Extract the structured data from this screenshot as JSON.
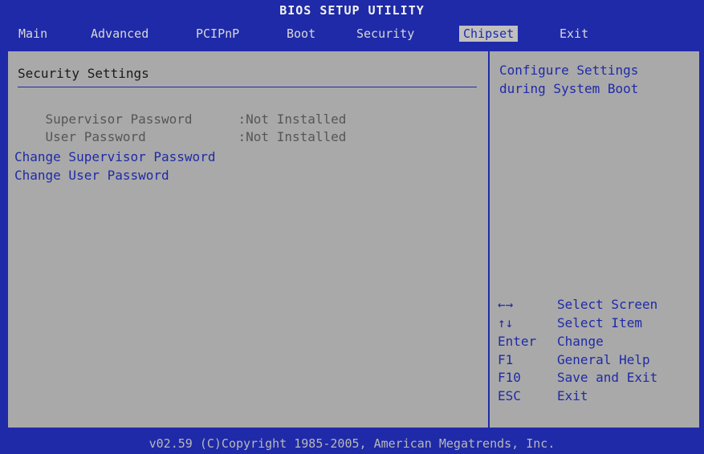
{
  "window": {
    "title": "BIOS SETUP UTILITY"
  },
  "menu": {
    "items": [
      "Main",
      "Advanced",
      "PCIPnP",
      "Boot",
      "Security",
      "Chipset",
      "Exit"
    ],
    "active": "Chipset"
  },
  "main": {
    "section_title": "Security Settings",
    "status": [
      {
        "label": "Supervisor Password",
        "value": ":Not Installed"
      },
      {
        "label": "User Password",
        "value": ":Not Installed"
      }
    ],
    "actions": [
      "Change Supervisor Password",
      "Change User Password"
    ]
  },
  "help_panel": {
    "description": "Configure Settings during System Boot",
    "keys": [
      {
        "key": "←→",
        "action": "Select Screen"
      },
      {
        "key": "↑↓",
        "action": "Select Item"
      },
      {
        "key": "Enter",
        "action": "Change"
      },
      {
        "key": "F1",
        "action": "General Help"
      },
      {
        "key": "F10",
        "action": "Save and Exit"
      },
      {
        "key": "ESC",
        "action": "Exit"
      }
    ]
  },
  "footer": {
    "text": "v02.59 (C)Copyright 1985-2005, American Megatrends, Inc."
  },
  "colors": {
    "background": "#a9a9a9",
    "accent": "#1f2aa8",
    "text_dim": "#565656"
  }
}
